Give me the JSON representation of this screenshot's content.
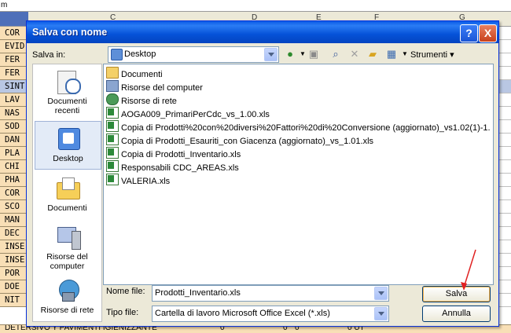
{
  "sheet": {
    "corner_text": "m",
    "column_letters": [
      "C",
      "D",
      "E",
      "F",
      "G"
    ],
    "rows": [
      "COR",
      "EVID",
      "FER",
      "FER",
      "SINT",
      "LAV",
      "NAS",
      "SOD",
      "DAN",
      "PLA",
      "CHI",
      "PHA",
      "COR",
      "SCO",
      "MAN",
      "DEC",
      "INSE",
      "INSE",
      "POR",
      "DOE",
      "NIT"
    ],
    "bottom_text": "DETERSIVO Y PAVIMENTI IGIENIZZANTE",
    "bottom_values": [
      "0",
      "0",
      "0",
      "0 UT"
    ]
  },
  "dialog": {
    "title": "Salva con nome",
    "help_label": "?",
    "close_label": "X",
    "save_in_label": "Salva in:",
    "save_in_value": "Desktop",
    "tools_label": "Strumenti",
    "places": [
      {
        "label": "Documenti recenti",
        "icon": "recent-documents-icon"
      },
      {
        "label": "Desktop",
        "icon": "desktop-icon"
      },
      {
        "label": "Documenti",
        "icon": "documents-folder-icon"
      },
      {
        "label": "Risorse del computer",
        "icon": "my-computer-icon"
      },
      {
        "label": "Risorse di rete",
        "icon": "network-icon"
      }
    ],
    "files": [
      {
        "name": "Documenti",
        "type": "folder"
      },
      {
        "name": "Risorse del computer",
        "type": "comp"
      },
      {
        "name": "Risorse di rete",
        "type": "net"
      },
      {
        "name": "AOGA009_PrimariPerCdc_vs_1.00.xls",
        "type": "xls"
      },
      {
        "name": "Copia di Prodotti%20con%20diversi%20Fattori%20di%20Conversione (aggiornato)_vs1.02(1)-1.",
        "type": "xls"
      },
      {
        "name": "Copia di Prodotti_Esauriti_con Giacenza (aggiornato)_vs_1.01.xls",
        "type": "xls"
      },
      {
        "name": "Copia di Prodotti_Inventario.xls",
        "type": "xls"
      },
      {
        "name": "Responsabili CDC_AREAS.xls",
        "type": "xls"
      },
      {
        "name": "VALERIA.xls",
        "type": "xls"
      }
    ],
    "filename_label": "Nome file:",
    "filename_value": "Prodotti_Inventario.xls",
    "filetype_label": "Tipo file:",
    "filetype_value": "Cartella di lavoro Microsoft Office Excel (*.xls)",
    "save_label": "Salva",
    "cancel_label": "Annulla"
  }
}
